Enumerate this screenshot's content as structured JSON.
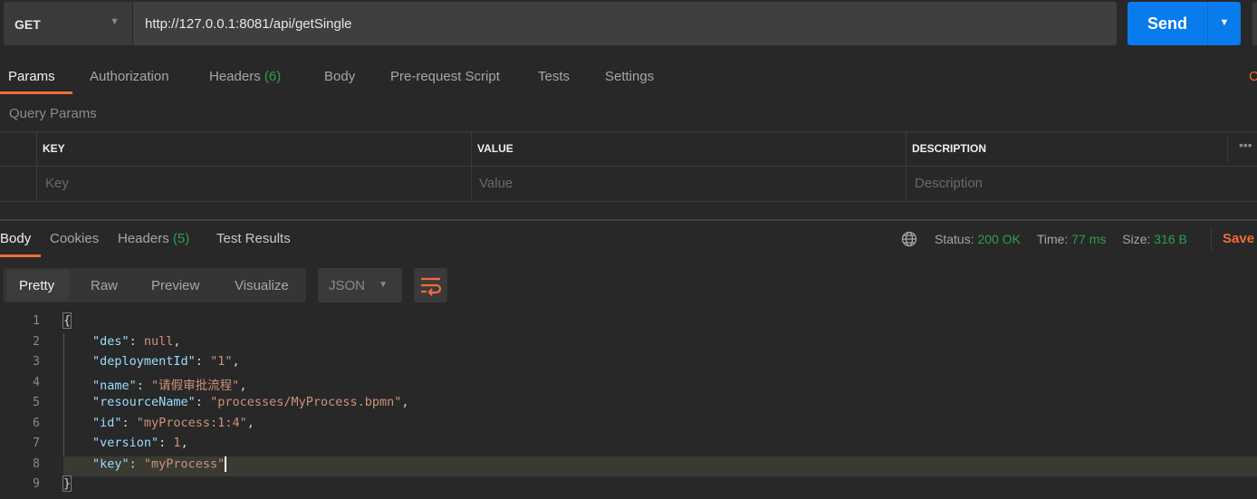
{
  "request": {
    "method": "GET",
    "url": "http://127.0.0.1:8081/api/getSingle",
    "send_label": "Send"
  },
  "request_tabs": [
    {
      "label": "Params"
    },
    {
      "label": "Authorization"
    },
    {
      "label": "Headers",
      "count": "(6)"
    },
    {
      "label": "Body"
    },
    {
      "label": "Pre-request Script"
    },
    {
      "label": "Tests"
    },
    {
      "label": "Settings"
    }
  ],
  "cookies_link": "C",
  "query_params": {
    "title": "Query Params",
    "columns": [
      "KEY",
      "VALUE",
      "DESCRIPTION"
    ],
    "placeholders": {
      "key": "Key",
      "value": "Value",
      "description": "Description"
    }
  },
  "response_tabs": [
    {
      "label": "Body"
    },
    {
      "label": "Cookies"
    },
    {
      "label": "Headers",
      "count": "(5)"
    },
    {
      "label": "Test Results"
    }
  ],
  "status": {
    "status_label": "Status:",
    "status": "200 OK",
    "time_label": "Time:",
    "time": "77 ms",
    "size_label": "Size:",
    "size": "316 B",
    "save_label": "Save"
  },
  "view_modes": [
    "Pretty",
    "Raw",
    "Preview",
    "Visualize"
  ],
  "format": "JSON",
  "code_lines": [
    {
      "no": "1",
      "text": "{"
    },
    {
      "no": "2",
      "key": "\"des\"",
      "val": "null",
      "end": ","
    },
    {
      "no": "3",
      "key": "\"deploymentId\"",
      "val": "\"1\"",
      "end": ","
    },
    {
      "no": "4",
      "key": "\"name\"",
      "val": "\"请假审批流程\"",
      "end": ","
    },
    {
      "no": "5",
      "key": "\"resourceName\"",
      "val": "\"processes/MyProcess.bpmn\"",
      "end": ","
    },
    {
      "no": "6",
      "key": "\"id\"",
      "val": "\"myProcess:1:4\"",
      "end": ","
    },
    {
      "no": "7",
      "key": "\"version\"",
      "val": "1",
      "end": ","
    },
    {
      "no": "8",
      "key": "\"key\"",
      "val": "\"myProcess\"",
      "end": ""
    },
    {
      "no": "9",
      "text": "}"
    }
  ],
  "colors": {
    "accent": "#f26b3a",
    "send": "#097bed",
    "green": "#2f9e4f"
  }
}
